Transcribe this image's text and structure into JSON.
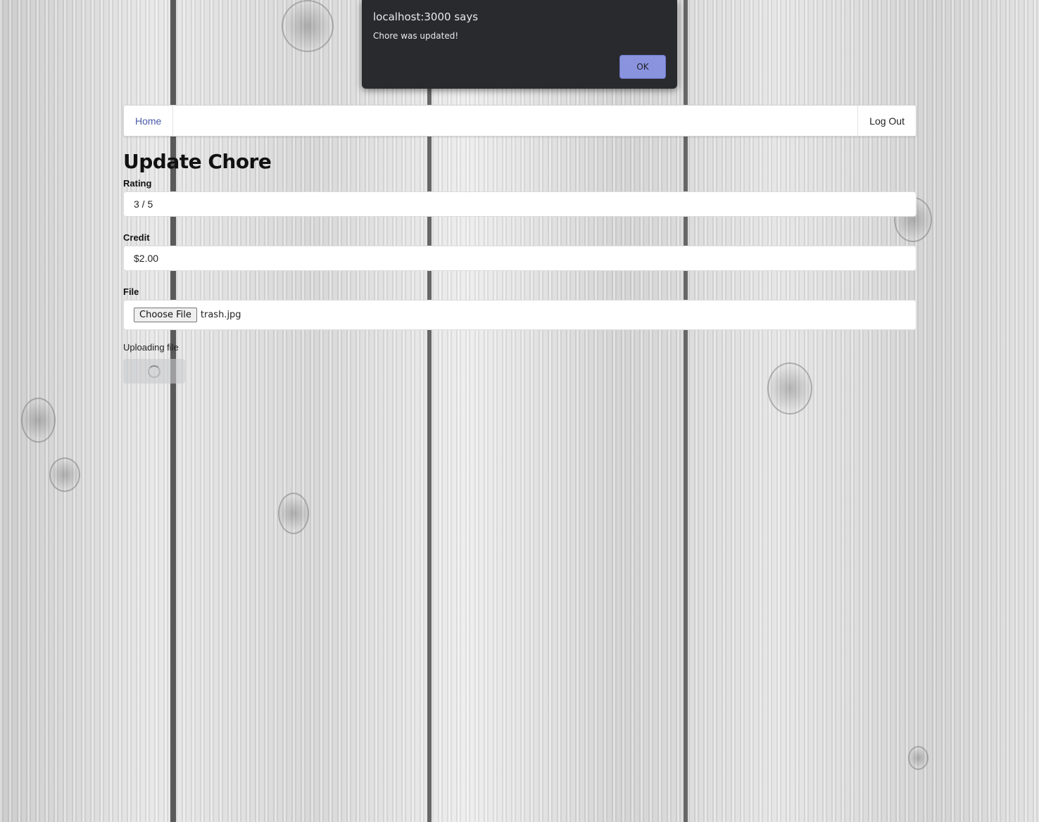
{
  "alert": {
    "title": "localhost:3000 says",
    "message": "Chore was updated!",
    "ok_label": "OK"
  },
  "navbar": {
    "home_label": "Home",
    "logout_label": "Log Out"
  },
  "page": {
    "title": "Update Chore"
  },
  "form": {
    "rating_label": "Rating",
    "rating_value": "3 / 5",
    "credit_label": "Credit",
    "credit_value": "$2.00",
    "file_label": "File",
    "choose_file_label": "Choose File",
    "file_name": "trash.jpg",
    "uploading_label": "Uploading file"
  },
  "colors": {
    "home_link": "#4a5aa8",
    "alert_background": "#292a2d",
    "alert_ok_button": "#8a93de"
  }
}
